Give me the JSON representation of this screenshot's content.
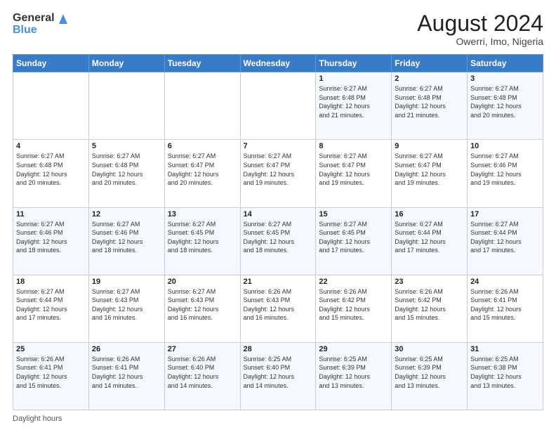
{
  "header": {
    "logo_line1": "General",
    "logo_line2": "Blue",
    "month_year": "August 2024",
    "location": "Owerri, Imo, Nigeria"
  },
  "footer": {
    "daylight_hours_label": "Daylight hours"
  },
  "weekdays": [
    "Sunday",
    "Monday",
    "Tuesday",
    "Wednesday",
    "Thursday",
    "Friday",
    "Saturday"
  ],
  "weeks": [
    [
      {
        "day": "",
        "info": ""
      },
      {
        "day": "",
        "info": ""
      },
      {
        "day": "",
        "info": ""
      },
      {
        "day": "",
        "info": ""
      },
      {
        "day": "1",
        "info": "Sunrise: 6:27 AM\nSunset: 6:48 PM\nDaylight: 12 hours\nand 21 minutes."
      },
      {
        "day": "2",
        "info": "Sunrise: 6:27 AM\nSunset: 6:48 PM\nDaylight: 12 hours\nand 21 minutes."
      },
      {
        "day": "3",
        "info": "Sunrise: 6:27 AM\nSunset: 6:48 PM\nDaylight: 12 hours\nand 20 minutes."
      }
    ],
    [
      {
        "day": "4",
        "info": "Sunrise: 6:27 AM\nSunset: 6:48 PM\nDaylight: 12 hours\nand 20 minutes."
      },
      {
        "day": "5",
        "info": "Sunrise: 6:27 AM\nSunset: 6:48 PM\nDaylight: 12 hours\nand 20 minutes."
      },
      {
        "day": "6",
        "info": "Sunrise: 6:27 AM\nSunset: 6:47 PM\nDaylight: 12 hours\nand 20 minutes."
      },
      {
        "day": "7",
        "info": "Sunrise: 6:27 AM\nSunset: 6:47 PM\nDaylight: 12 hours\nand 19 minutes."
      },
      {
        "day": "8",
        "info": "Sunrise: 6:27 AM\nSunset: 6:47 PM\nDaylight: 12 hours\nand 19 minutes."
      },
      {
        "day": "9",
        "info": "Sunrise: 6:27 AM\nSunset: 6:47 PM\nDaylight: 12 hours\nand 19 minutes."
      },
      {
        "day": "10",
        "info": "Sunrise: 6:27 AM\nSunset: 6:46 PM\nDaylight: 12 hours\nand 19 minutes."
      }
    ],
    [
      {
        "day": "11",
        "info": "Sunrise: 6:27 AM\nSunset: 6:46 PM\nDaylight: 12 hours\nand 18 minutes."
      },
      {
        "day": "12",
        "info": "Sunrise: 6:27 AM\nSunset: 6:46 PM\nDaylight: 12 hours\nand 18 minutes."
      },
      {
        "day": "13",
        "info": "Sunrise: 6:27 AM\nSunset: 6:45 PM\nDaylight: 12 hours\nand 18 minutes."
      },
      {
        "day": "14",
        "info": "Sunrise: 6:27 AM\nSunset: 6:45 PM\nDaylight: 12 hours\nand 18 minutes."
      },
      {
        "day": "15",
        "info": "Sunrise: 6:27 AM\nSunset: 6:45 PM\nDaylight: 12 hours\nand 17 minutes."
      },
      {
        "day": "16",
        "info": "Sunrise: 6:27 AM\nSunset: 6:44 PM\nDaylight: 12 hours\nand 17 minutes."
      },
      {
        "day": "17",
        "info": "Sunrise: 6:27 AM\nSunset: 6:44 PM\nDaylight: 12 hours\nand 17 minutes."
      }
    ],
    [
      {
        "day": "18",
        "info": "Sunrise: 6:27 AM\nSunset: 6:44 PM\nDaylight: 12 hours\nand 17 minutes."
      },
      {
        "day": "19",
        "info": "Sunrise: 6:27 AM\nSunset: 6:43 PM\nDaylight: 12 hours\nand 16 minutes."
      },
      {
        "day": "20",
        "info": "Sunrise: 6:27 AM\nSunset: 6:43 PM\nDaylight: 12 hours\nand 16 minutes."
      },
      {
        "day": "21",
        "info": "Sunrise: 6:26 AM\nSunset: 6:43 PM\nDaylight: 12 hours\nand 16 minutes."
      },
      {
        "day": "22",
        "info": "Sunrise: 6:26 AM\nSunset: 6:42 PM\nDaylight: 12 hours\nand 15 minutes."
      },
      {
        "day": "23",
        "info": "Sunrise: 6:26 AM\nSunset: 6:42 PM\nDaylight: 12 hours\nand 15 minutes."
      },
      {
        "day": "24",
        "info": "Sunrise: 6:26 AM\nSunset: 6:41 PM\nDaylight: 12 hours\nand 15 minutes."
      }
    ],
    [
      {
        "day": "25",
        "info": "Sunrise: 6:26 AM\nSunset: 6:41 PM\nDaylight: 12 hours\nand 15 minutes."
      },
      {
        "day": "26",
        "info": "Sunrise: 6:26 AM\nSunset: 6:41 PM\nDaylight: 12 hours\nand 14 minutes."
      },
      {
        "day": "27",
        "info": "Sunrise: 6:26 AM\nSunset: 6:40 PM\nDaylight: 12 hours\nand 14 minutes."
      },
      {
        "day": "28",
        "info": "Sunrise: 6:25 AM\nSunset: 6:40 PM\nDaylight: 12 hours\nand 14 minutes."
      },
      {
        "day": "29",
        "info": "Sunrise: 6:25 AM\nSunset: 6:39 PM\nDaylight: 12 hours\nand 13 minutes."
      },
      {
        "day": "30",
        "info": "Sunrise: 6:25 AM\nSunset: 6:39 PM\nDaylight: 12 hours\nand 13 minutes."
      },
      {
        "day": "31",
        "info": "Sunrise: 6:25 AM\nSunset: 6:38 PM\nDaylight: 12 hours\nand 13 minutes."
      }
    ]
  ]
}
